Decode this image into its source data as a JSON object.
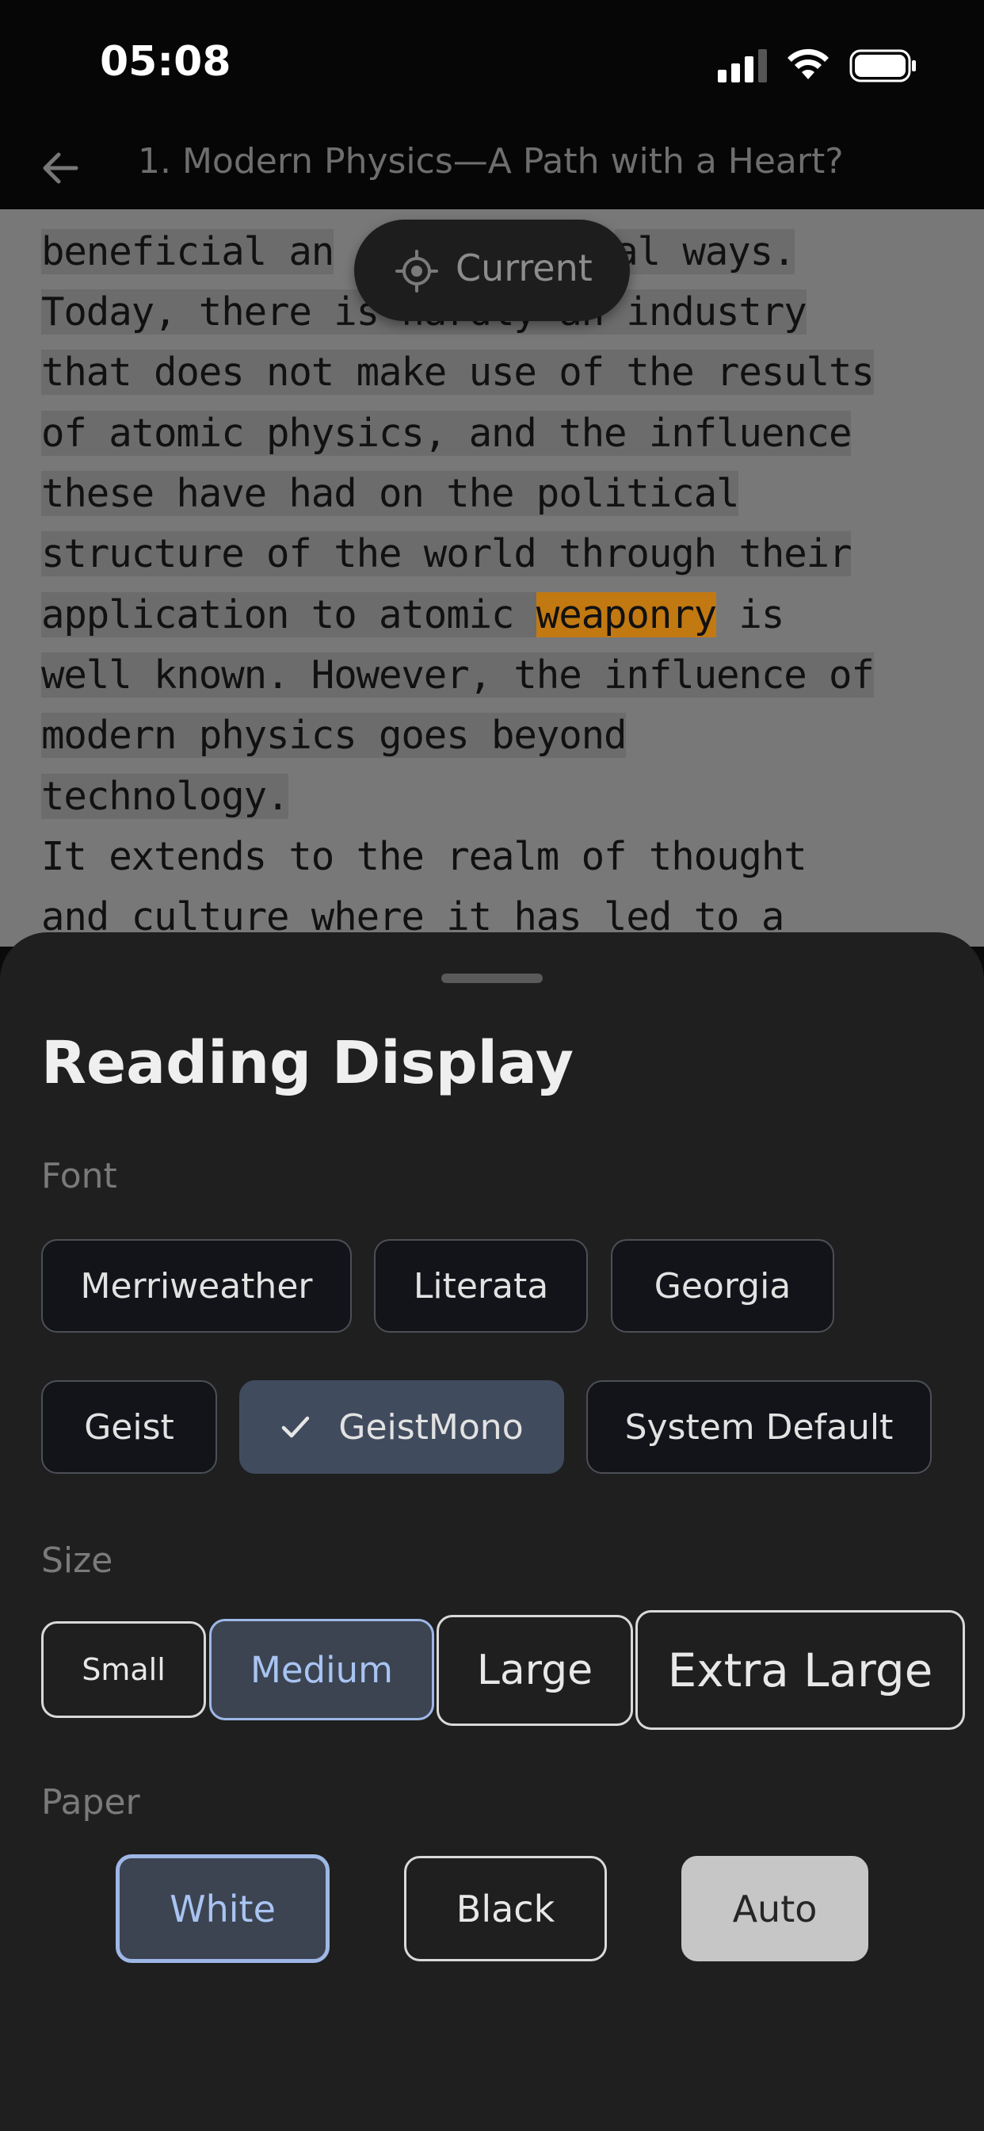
{
  "status_bar": {
    "time": "05:08"
  },
  "nav": {
    "title": "1. Modern Physics—A Path with a Heart?"
  },
  "reader": {
    "lines": [
      "beneficial an",
      "al ways.",
      "Today, there is hardly an industry",
      "that does not make use of the results",
      "of atomic physics, and the influence",
      "these have had on the political",
      "structure of the world through their",
      "application to atomic ",
      "weaponry",
      " is",
      "well known. However, the influence of",
      "modern physics goes beyond",
      "technology.",
      "It extends to the realm of thought",
      "and culture where it has led to a"
    ],
    "current_button": "Current"
  },
  "sheet": {
    "title": "Reading Display",
    "font_label": "Font",
    "fonts": [
      "Merriweather",
      "Literata",
      "Georgia",
      "Geist",
      "GeistMono",
      "System Default"
    ],
    "selected_font": "GeistMono",
    "size_label": "Size",
    "sizes": [
      "Small",
      "Medium",
      "Large",
      "Extra Large"
    ],
    "selected_size": "Medium",
    "paper_label": "Paper",
    "papers": [
      "White",
      "Black",
      "Auto"
    ],
    "selected_paper": "White"
  },
  "colors": {
    "highlight": "#c27912",
    "selected_accent": "#9eb7e6",
    "sheet_bg": "#1f1f1f"
  }
}
